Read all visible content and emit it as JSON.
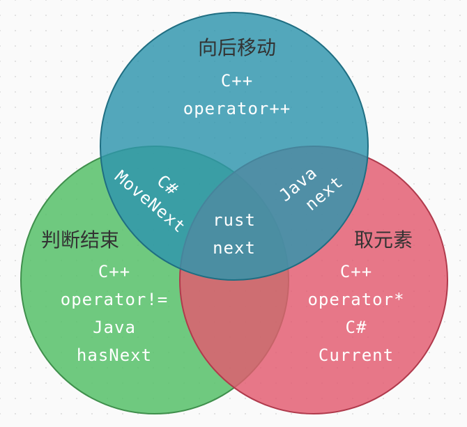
{
  "colors": {
    "background": "#fafafa",
    "top_circle": "#3a9fb5",
    "left_circle": "#56bf68",
    "right_circle": "#e35a6f",
    "title_text": "#333333",
    "code_text": "#ffffff"
  },
  "sets": {
    "move_next": {
      "title": "向后移动",
      "lines": [
        "C++",
        "operator++"
      ]
    },
    "end_check": {
      "title": "判断结束",
      "lines": [
        "C++",
        "operator!=",
        "Java",
        "hasNext"
      ]
    },
    "get_element": {
      "title": "取元素",
      "lines": [
        "C++",
        "operator*",
        "C#",
        "Current"
      ]
    }
  },
  "overlaps": {
    "move_and_end": {
      "lines": [
        "C#",
        "MoveNext"
      ]
    },
    "move_and_get": {
      "lines": [
        "Java",
        "next"
      ]
    },
    "all_three": {
      "lines": [
        "rust",
        "next"
      ]
    }
  }
}
